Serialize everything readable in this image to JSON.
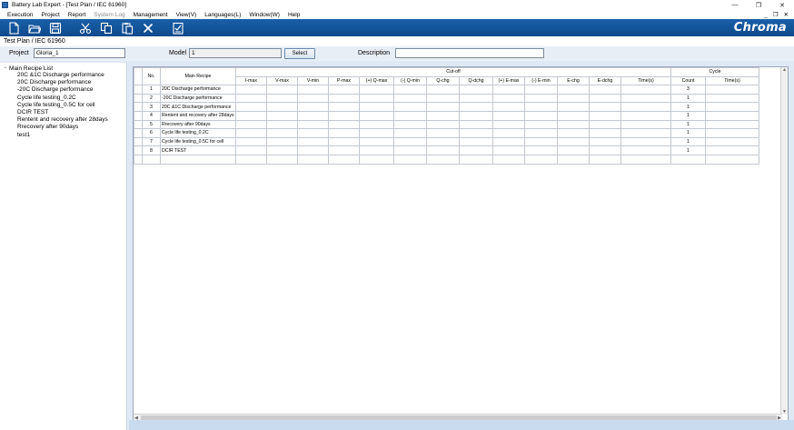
{
  "window": {
    "title": "Battery Lab Expert - [Test Plan / IEC 61960]",
    "controls": [
      "—",
      "❐",
      "✕"
    ]
  },
  "menu": {
    "items": [
      "Execution",
      "Project",
      "Report",
      "System Log",
      "Management",
      "View(V)",
      "Languages(L)",
      "Window(W)",
      "Help"
    ],
    "mdi_controls": [
      "_",
      "❐",
      "✕"
    ]
  },
  "toolbar": {
    "icons": [
      "new-file-icon",
      "open-folder-icon",
      "save-icon",
      "cut-icon",
      "copy-icon",
      "paste-icon",
      "delete-icon",
      "checklist-icon"
    ],
    "brand": "Chroma"
  },
  "header": {
    "path": "Test Plan / IEC 61960"
  },
  "form": {
    "project_label": "Project",
    "project_value": "Gloria_1",
    "model_label": "Model",
    "model_value": "1",
    "select_label": "Select",
    "description_label": "Description",
    "description_value": ""
  },
  "tree": {
    "root": "Main Recipe List",
    "toggle": "−",
    "items": [
      "20C &1C Discharge performance",
      "20C Discharge performance",
      "-20C Discharge performance",
      "Cycle life testing_0.2C",
      "Cycle life testing_0.5C for cell",
      "DCIR TEST",
      "Rentent and recovery after 28days",
      "Rrecovery after 90days",
      "test1"
    ]
  },
  "table": {
    "headers": {
      "no": "No.",
      "recipe": "Main Recipe",
      "cutoff": "Cut-off",
      "cycle": "Cycle",
      "cutoff_cols": [
        "I-max",
        "V-max",
        "V-min",
        "P-max",
        "(+) Q-max",
        "(-) Q-min",
        "Q-chg",
        "Q-dchg",
        "(+) E-max",
        "(-) E-min",
        "E-chg",
        "E-dchg",
        "Time(s)"
      ],
      "cycle_cols": [
        "Count",
        "Time(s)"
      ]
    },
    "rows": [
      {
        "no": "1",
        "recipe": "20C Discharge performance",
        "count": "3"
      },
      {
        "no": "2",
        "recipe": "-20C Discharge performance",
        "count": "1"
      },
      {
        "no": "3",
        "recipe": "20C &1C Discharge performance",
        "count": "1"
      },
      {
        "no": "4",
        "recipe": "Rentent and recovery after 28days",
        "count": "1"
      },
      {
        "no": "5",
        "recipe": "Rrecovery after 90days",
        "count": "1"
      },
      {
        "no": "6",
        "recipe": "Cycle life testing_0.2C",
        "count": "1"
      },
      {
        "no": "7",
        "recipe": "Cycle life testing_0.5C for cell",
        "count": "1"
      },
      {
        "no": "8",
        "recipe": "DCIR TEST",
        "count": "1"
      }
    ]
  }
}
